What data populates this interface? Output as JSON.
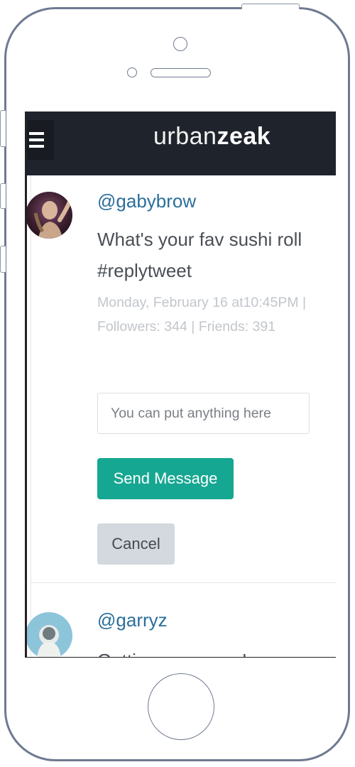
{
  "app": {
    "brand_light": "urban",
    "brand_bold": "zeak"
  },
  "colors": {
    "header_bg": "#1f242c",
    "handle": "#2a6f9a",
    "send_button": "#16a792",
    "cancel_button": "#d3d9de",
    "meta_text": "#c2c6cb"
  },
  "icons": {
    "menu": "hamburger-menu-icon"
  },
  "tweets": [
    {
      "handle": "@gabybrow",
      "text": "What's your fav sushi roll #replytweet",
      "meta": "Monday, February 16 at10:45PM | Followers: 344 | Friends: 391",
      "reply_placeholder": "You can put anything here",
      "send_label": "Send Message",
      "cancel_label": "Cancel"
    },
    {
      "handle": "@garryz",
      "text": "Getting a new car!"
    }
  ]
}
